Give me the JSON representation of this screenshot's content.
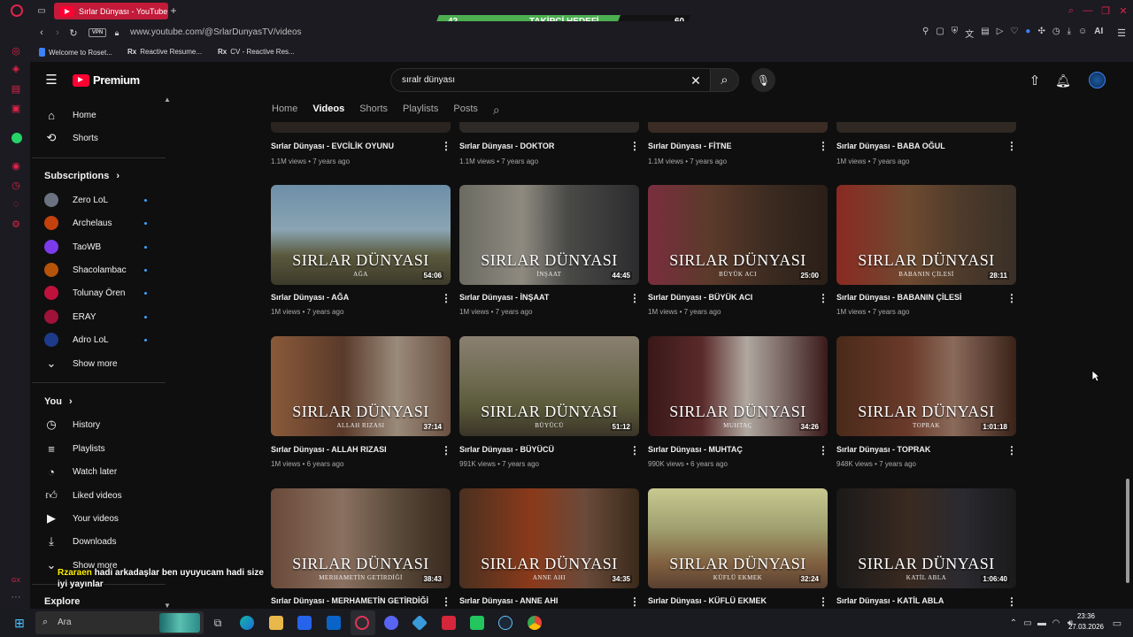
{
  "browser": {
    "tab_title": "Sırlar Dünyası - YouTube",
    "url": "www.youtube.com/@SrlarDunyasTV/videos",
    "vpn_label": "VPN",
    "ai_label": "AI",
    "bookmarks": [
      "Welcome to Roset...",
      "Reactive Resume...",
      "CV - Reactive Res..."
    ]
  },
  "goal_overlay": {
    "current": "42",
    "label": "TAKİPÇİ HEDEFİ",
    "target": "60",
    "fill_color": "#4caf50",
    "progress_fraction": 0.7
  },
  "youtube": {
    "logo_text": "Premium",
    "search_value": "sıralr dünyası",
    "channel_tabs": [
      "Home",
      "Videos",
      "Shorts",
      "Playlists",
      "Posts"
    ],
    "active_tab": "Videos"
  },
  "sidebar": {
    "main": [
      {
        "label": "Home",
        "icon": "home-icon"
      },
      {
        "label": "Shorts",
        "icon": "shorts-icon"
      }
    ],
    "subscriptions_header": "Subscriptions",
    "subscriptions": [
      {
        "name": "Zero LoL",
        "color": "#6b7280"
      },
      {
        "name": "Archelaus",
        "color": "#c2410c"
      },
      {
        "name": "TaoWB",
        "color": "#7c3aed"
      },
      {
        "name": "Shacolambac",
        "color": "#b45309"
      },
      {
        "name": "Tolunay Ören",
        "color": "#be123c"
      },
      {
        "name": "ERAY",
        "color": "#9f1239"
      },
      {
        "name": "Adro LoL",
        "color": "#1e3a8a"
      }
    ],
    "show_more": "Show more",
    "you_header": "You",
    "you_items": [
      {
        "label": "History",
        "icon": "history-icon"
      },
      {
        "label": "Playlists",
        "icon": "playlists-icon"
      },
      {
        "label": "Watch later",
        "icon": "watch-later-icon"
      },
      {
        "label": "Liked videos",
        "icon": "like-icon"
      },
      {
        "label": "Your videos",
        "icon": "your-videos-icon"
      },
      {
        "label": "Downloads",
        "icon": "download-icon"
      }
    ],
    "show_more_2": "Show more",
    "explore": "Explore"
  },
  "chat_overlay": {
    "user": "Rzaraen",
    "message": "hadi arkadaşlar ben uyuyucam hadi size iyi yayınlar"
  },
  "thumb_title": "SIRLAR DÜNYASI",
  "rows": [
    [
      {
        "title": "Sırlar Dünyası - EVCİLİK OYUNU",
        "meta": "1.1M views • 7 years ago"
      },
      {
        "title": "Sırlar Dünyası - DOKTOR",
        "meta": "1.1M views • 7 years ago"
      },
      {
        "title": "Sırlar Dünyası - FİTNE",
        "meta": "1.1M views • 7 years ago"
      },
      {
        "title": "Sırlar Dünyası - BABA OĞUL",
        "meta": "1M views • 7 years ago"
      }
    ],
    [
      {
        "title": "Sırlar Dünyası - AĞA",
        "meta": "1M views • 7 years ago",
        "sub": "AĞA",
        "dur": "54:06",
        "bg": "linear-gradient(180deg,#6d8fa8 0%,#8aa4b3 45%,#5b5a3e 70%,#3c3a2a 100%)"
      },
      {
        "title": "Sırlar Dünyası - İNŞAAT",
        "meta": "1M views • 7 years ago",
        "sub": "İNŞAAT",
        "dur": "44:45",
        "bg": "linear-gradient(90deg,#6b6b62 0%,#8e8a80 35%,#4a4a48 60%,#2c2c2e 100%)"
      },
      {
        "title": "Sırlar Dünyası - BÜYÜK ACI",
        "meta": "1M views • 7 years ago",
        "sub": "BÜYÜK ACI",
        "dur": "25:00",
        "bg": "linear-gradient(90deg,#7a2e3e 0%,#5b3a2a 35%,#3a2a20 70%,#2a1f18 100%)"
      },
      {
        "title": "Sırlar Dünyası - BABANIN ÇİLESİ",
        "meta": "1M views • 7 years ago",
        "sub": "BABANIN ÇİLESİ",
        "dur": "28:11",
        "bg": "linear-gradient(90deg,#8a2a22 0%,#6e4a30 40%,#4d3a2a 70%,#3a3028 100%)"
      }
    ],
    [
      {
        "title": "Sırlar Dünyası - ALLAH RIZASI",
        "meta": "1M views • 6 years ago",
        "sub": "ALLAH RIZASI",
        "dur": "37:14",
        "bg": "linear-gradient(90deg,#8a5a3a 0%,#5a3a2a 40%,#9a8a7a 70%,#6a5040 100%)"
      },
      {
        "title": "Sırlar Dünyası - BÜYÜCÜ",
        "meta": "991K views • 7 years ago",
        "sub": "BÜYÜCÜ",
        "dur": "51:12",
        "bg": "linear-gradient(180deg,#8a8070 0%,#6e6a50 45%,#5a5a3a 70%,#3a3428 100%)"
      },
      {
        "title": "Sırlar Dünyası - MUHTAÇ",
        "meta": "990K views • 6 years ago",
        "sub": "MUHTAÇ",
        "dur": "34:26",
        "bg": "linear-gradient(90deg,#3a1818 0%,#5a2a2a 30%,#b0a8a0 55%,#3a1a1a 100%)"
      },
      {
        "title": "Sırlar Dünyası - TOPRAK",
        "meta": "948K views • 7 years ago",
        "sub": "TOPRAK",
        "dur": "1:01:18",
        "bg": "linear-gradient(90deg,#4a2a1a 0%,#6a3a2a 40%,#8a6a5a 65%,#3a2218 100%)"
      }
    ],
    [
      {
        "title": "Sırlar Dünyası - MERHAMETİN GETİRDİĞİ",
        "meta": "",
        "sub": "MERHAMETİN GETİRDİĞİ",
        "dur": "38:43",
        "bg": "linear-gradient(90deg,#6a4a3a 0%,#8a7060 40%,#5a4a3a 70%,#3a2a20 100%)"
      },
      {
        "title": "Sırlar Dünyası - ANNE AHI",
        "meta": "",
        "sub": "ANNE AHI",
        "dur": "34:35",
        "bg": "linear-gradient(90deg,#4a3020 0%,#8a3a1a 40%,#6a4a3a 70%,#3a2a1a 100%)"
      },
      {
        "title": "Sırlar Dünyası - KÜFLÜ EKMEK",
        "meta": "",
        "sub": "KÜFLÜ EKMEK",
        "dur": "32:24",
        "bg": "linear-gradient(180deg,#c8c890 0%,#a0a070 40%,#806040 75%,#5a4030 100%)"
      },
      {
        "title": "Sırlar Dünyası - KATİL ABLA",
        "meta": "",
        "sub": "KATİL ABLA",
        "dur": "1:06:40",
        "bg": "linear-gradient(90deg,#1a1a1a 0%,#3a2a20 40%,#2a2a30 70%,#1a1a1a 100%)"
      }
    ]
  ],
  "taskbar": {
    "search_placeholder": "Ara",
    "time": "23:36",
    "date": "27.03.2026"
  }
}
